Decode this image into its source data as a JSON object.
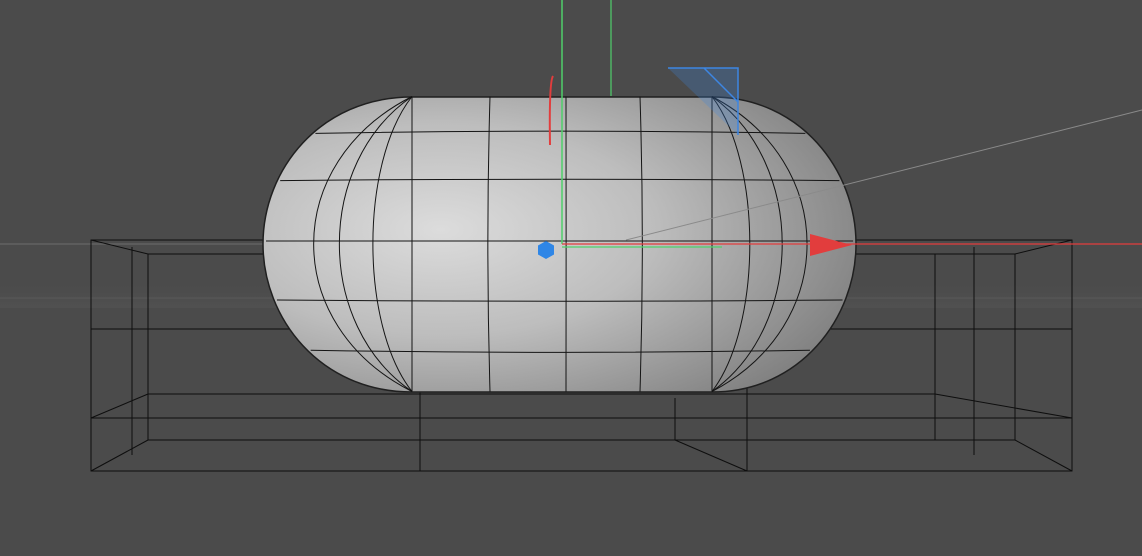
{
  "viewport": {
    "name": "3d-viewport",
    "background": "#4b4b4b"
  },
  "objects": [
    {
      "name": "capsule",
      "kind": "capsule-mesh",
      "shading": "gray-gradient",
      "selected": true
    },
    {
      "name": "box-wireframe",
      "kind": "box-wireframe",
      "selected": false
    }
  ],
  "gizmo": {
    "x_axis_color": "#e23d3d",
    "y_axis_color": "#4fd06a",
    "z_axis_color": "#3d86e2"
  },
  "colors": {
    "mesh_edge": "#111111",
    "wire": "#0e0e0e",
    "horizon_line": "#777777"
  }
}
